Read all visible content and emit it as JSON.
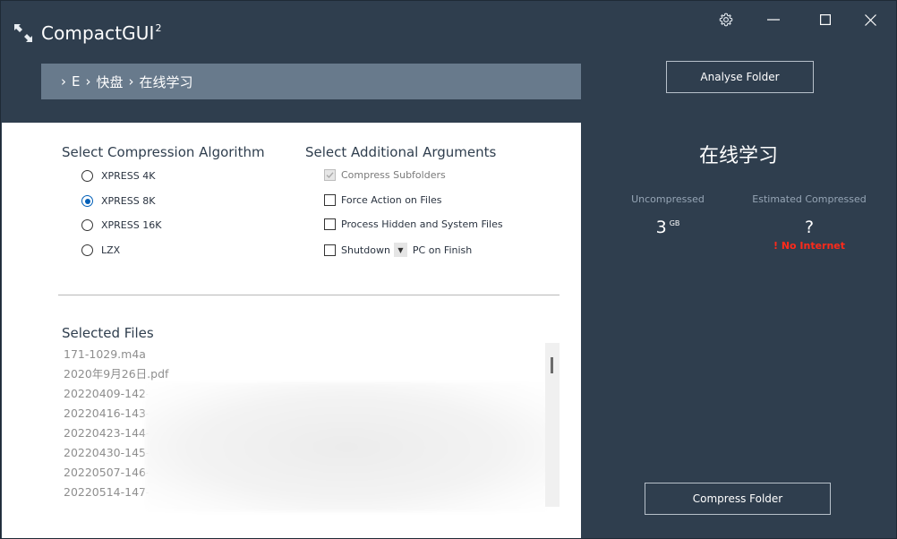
{
  "app": {
    "title": "CompactGUI",
    "title_sup": "2"
  },
  "window_controls": {
    "settings_icon": "gear-icon",
    "minimize_icon": "minimize-icon",
    "maximize_icon": "maximize-icon",
    "close_icon": "close-icon"
  },
  "breadcrumb": {
    "items": [
      "E",
      "快盘",
      "在线学习"
    ]
  },
  "analyse_button": "Analyse Folder",
  "compression": {
    "title": "Select Compression Algorithm",
    "options": [
      {
        "label": "XPRESS 4K",
        "selected": false
      },
      {
        "label": "XPRESS 8K",
        "selected": true
      },
      {
        "label": "XPRESS 16K",
        "selected": false
      },
      {
        "label": "LZX",
        "selected": false
      }
    ]
  },
  "arguments": {
    "title": "Select Additional Arguments",
    "compress_subfolders": "Compress Subfolders",
    "force_action": "Force Action on Files",
    "process_hidden": "Process Hidden and System Files",
    "shutdown_prefix": "Shutdown",
    "shutdown_suffix": "PC on Finish"
  },
  "selected_files": {
    "title": "Selected Files",
    "files": [
      "171-1029.m4a",
      "2020年9月26日.pdf",
      "20220409-142-",
      "20220416-143-",
      "20220423-144-",
      "20220430-145-",
      "20220507-146-",
      "20220514-147-"
    ]
  },
  "summary": {
    "folder_name": "在线学习",
    "uncompressed_label": "Uncompressed",
    "uncompressed_value": "3",
    "uncompressed_unit": "GB",
    "estimated_label": "Estimated Compressed",
    "estimated_value": "?",
    "warning": "! No Internet"
  },
  "compress_button": "Compress Folder",
  "colors": {
    "background": "#2f3e4e",
    "breadcrumb_bg": "#687a8c",
    "accent": "#005fb8",
    "warning": "#ff2a1a"
  }
}
